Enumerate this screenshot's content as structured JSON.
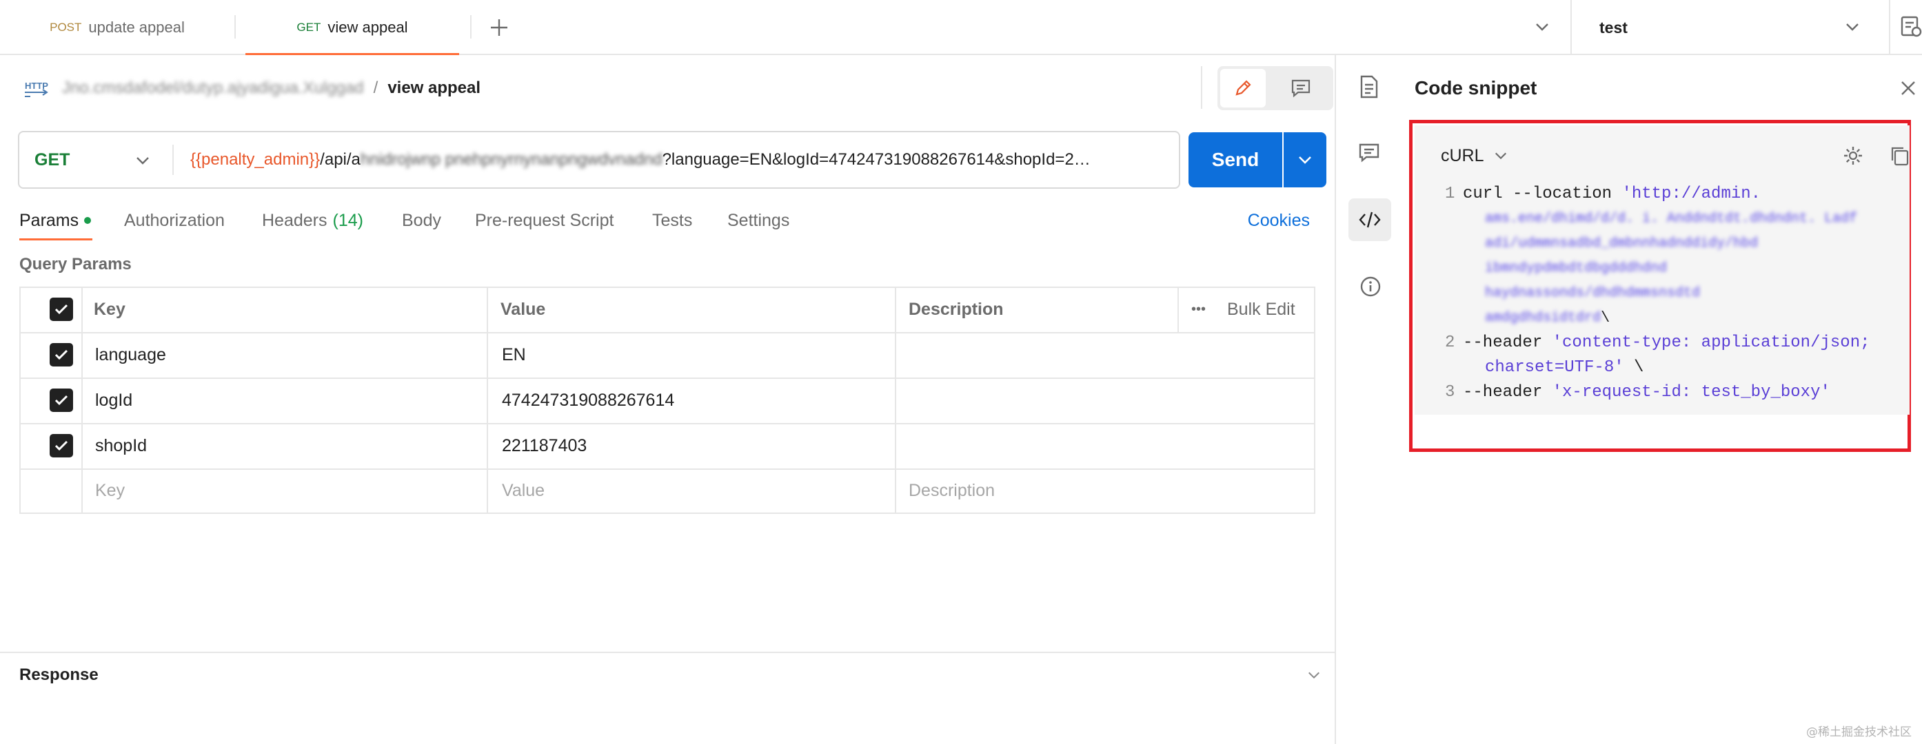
{
  "tabs": [
    {
      "method": "POST",
      "name": "update appeal",
      "method_color": "#b0883d"
    },
    {
      "method": "GET",
      "name": "view appeal",
      "method_color": "#1a7f37",
      "active": true
    }
  ],
  "environment": {
    "name": "test"
  },
  "breadcrumb": {
    "collection_obscured": "Jno.cmsdafodel/dutyp.ajyadigua.Xulggad",
    "separator": "/",
    "request": "view appeal"
  },
  "request": {
    "method": "GET",
    "url_variable": "{{penalty_admin}}",
    "url_path_start": "/api/a",
    "url_obscured": "hnidrojwnp   pnehpnyrnynanpngwdvnadnd",
    "url_rest": "?language=EN&logId=474247319088267614&shopId=2…",
    "send_label": "Send"
  },
  "req_tabs": [
    {
      "label": "Params",
      "dot": true,
      "active": true
    },
    {
      "label": "Authorization"
    },
    {
      "label": "Headers",
      "count": "(14)"
    },
    {
      "label": "Body"
    },
    {
      "label": "Pre-request Script"
    },
    {
      "label": "Tests"
    },
    {
      "label": "Settings"
    }
  ],
  "cookies_label": "Cookies",
  "query_params": {
    "title": "Query Params",
    "headers": {
      "key": "Key",
      "value": "Value",
      "description": "Description",
      "more": "•••",
      "bulk_edit": "Bulk Edit"
    },
    "rows": [
      {
        "key": "language",
        "value": "EN",
        "checked": true
      },
      {
        "key": "logId",
        "value": "474247319088267614",
        "checked": true
      },
      {
        "key": "shopId",
        "value": "221187403",
        "checked": true
      }
    ],
    "placeholders": {
      "key": "Key",
      "value": "Value",
      "description": "Description"
    }
  },
  "response": {
    "title": "Response"
  },
  "snippet": {
    "title": "Code snippet",
    "language": "cURL",
    "lines": [
      {
        "num": "1",
        "cmd": "curl --location ",
        "str": "'http://admin."
      },
      {
        "obscured": [
          "ams.ene/dhimd/d/d. i. Anddndtdt.dhdndnt. Ladf",
          "adi/udmmnsadbd_dmbnnhadnddidy/hbd",
          "ibmndypdmbdtdbgdddhdnd",
          "haydnassonds/dhdhdmmsnsdtd",
          "amdgdhdsidtdrd"
        ]
      },
      {
        "tail": " \\"
      },
      {
        "num": "2",
        "cmd": "--header ",
        "str": "'content-type: application/json;"
      },
      {
        "cont": "charset=UTF-8'",
        "tail": " \\"
      },
      {
        "num": "3",
        "cmd": "--header ",
        "str": "'x-request-id: test_by_boxy'"
      }
    ]
  },
  "watermark": "@稀土掘金技术社区"
}
